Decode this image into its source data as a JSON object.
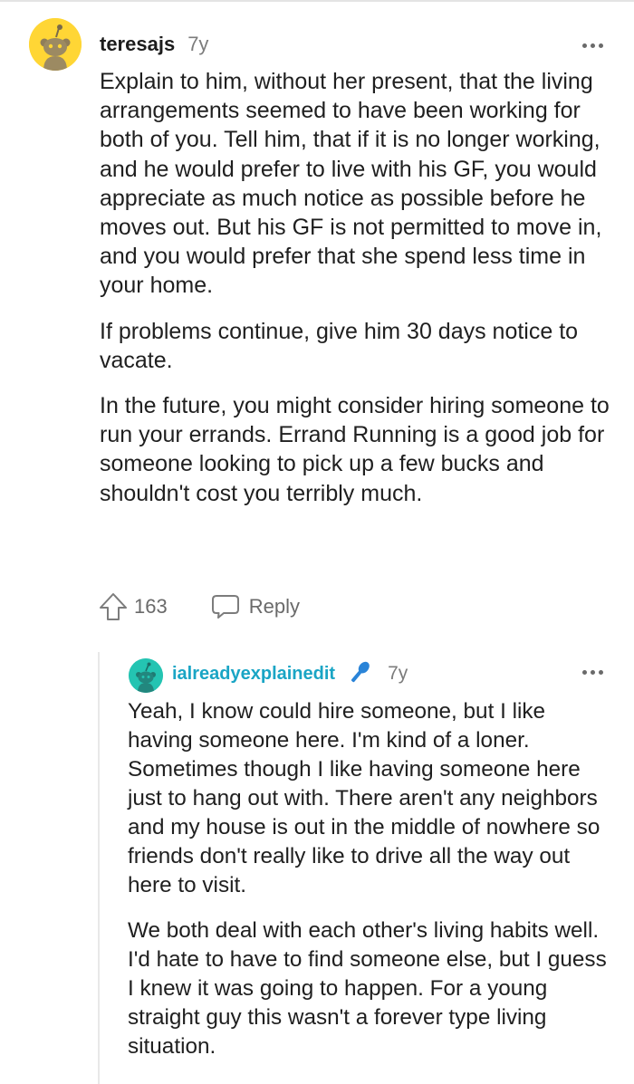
{
  "comments": [
    {
      "username": "teresajs",
      "age": "7y",
      "paragraphs": [
        "Explain to him, without her present, that the living arrangements seemed to have been working for both of you. Tell him, that if it is no longer working, and he would prefer to live with his GF, you would appreciate as much notice as possible before he moves out. But his GF is not permitted to move in, and you would prefer that she spend less time in your home.",
        "If problems continue, give him 30 days notice to vacate.",
        "In the future, you might consider hiring someone to run your errands. Errand Running is a good job for someone looking to pick up a few bucks and shouldn't cost you terribly much."
      ],
      "upvotes": "163",
      "reply_label": "Reply",
      "avatar_color": "#ffd635",
      "icons": {
        "upvote": "upvote-arrow-icon",
        "reply": "speech-bubble-icon",
        "more": "more-options-icon"
      }
    },
    {
      "username": "ialreadyexplainedit",
      "age": "7y",
      "is_op": true,
      "username_color": "#1aa5c5",
      "avatar_color": "#24c4b2",
      "flair_icon": "microphone-icon",
      "paragraphs": [
        "Yeah, I know could hire someone, but I like having someone here. I'm kind of a loner. Sometimes though I like having someone here just to hang out with. There aren't any neighbors and my house is out in the middle of nowhere so friends don't really like to drive all the way out here to visit.",
        "We both deal with each other's living habits well. I'd hate to have to find someone else, but I guess I knew it was going to happen. For a young straight guy this wasn't a forever type living situation."
      ]
    }
  ]
}
